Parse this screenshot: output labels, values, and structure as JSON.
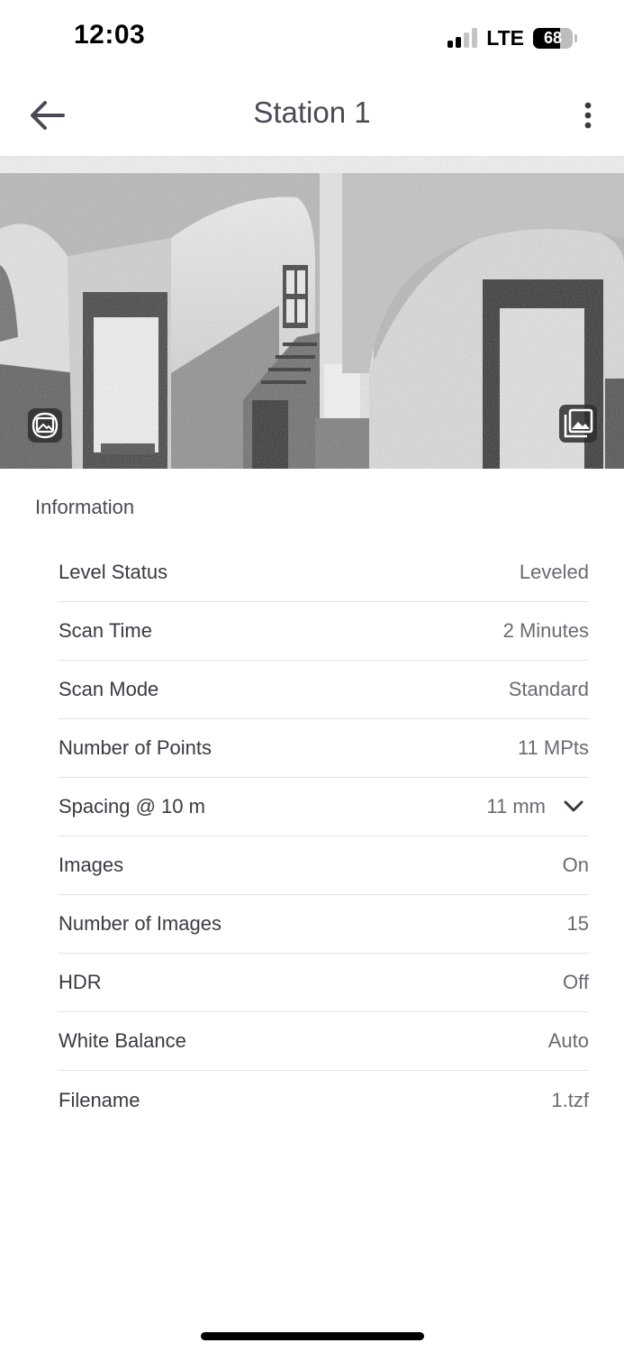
{
  "status_bar": {
    "time": "12:03",
    "network": "LTE",
    "battery_level": "68",
    "signal_bars_active": 2,
    "signal_bars_total": 4
  },
  "nav": {
    "title": "Station 1",
    "back_icon": "arrow-left-icon",
    "more_icon": "vertical-ellipsis-icon"
  },
  "panorama": {
    "left_button_icon": "image-icon",
    "right_button_icon": "image-gallery-icon"
  },
  "information": {
    "title": "Information",
    "rows": [
      {
        "label": "Level Status",
        "value": "Leveled"
      },
      {
        "label": "Scan Time",
        "value": "2 Minutes"
      },
      {
        "label": "Scan Mode",
        "value": "Standard"
      },
      {
        "label": "Number of Points",
        "value": "11 MPts"
      },
      {
        "label": "Spacing @ 10 m",
        "value": "11 mm",
        "has_dropdown": true
      },
      {
        "label": "Images",
        "value": "On"
      },
      {
        "label": "Number of Images",
        "value": "15"
      },
      {
        "label": "HDR",
        "value": "Off"
      },
      {
        "label": "White Balance",
        "value": "Auto"
      },
      {
        "label": "Filename",
        "value": "1.tzf"
      }
    ]
  },
  "colors": {
    "text_primary": "#3a3a44",
    "text_secondary": "#6a6a74",
    "divider": "#e2e2e6"
  }
}
